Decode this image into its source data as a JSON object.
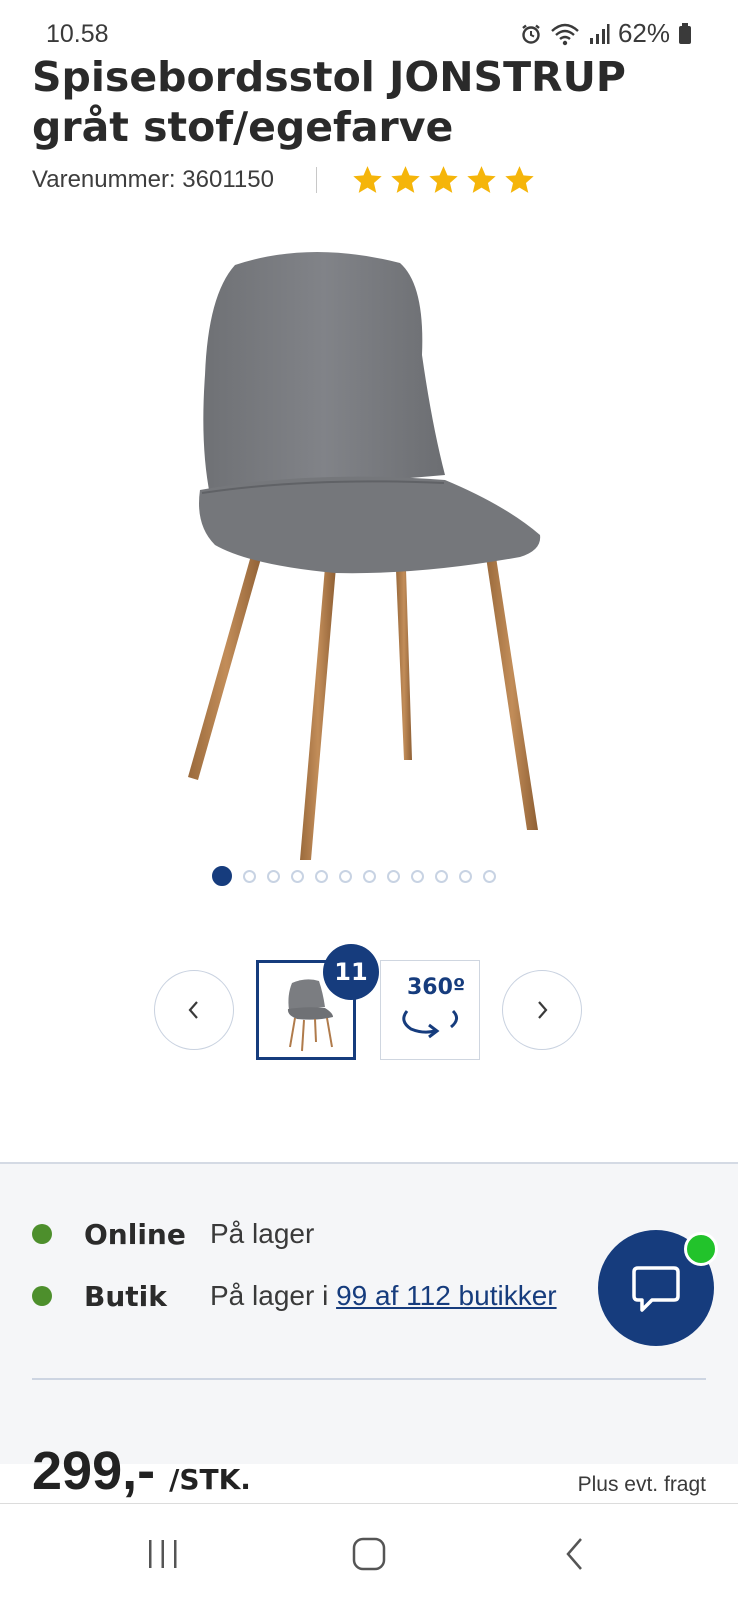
{
  "status_bar": {
    "time": "10.58",
    "battery": "62%"
  },
  "product": {
    "title": "Spisebordsstol JONSTRUP gråt stof/egefarve",
    "sku_label": "Varenummer: 3601150",
    "rating": {
      "stars": 5,
      "max": 5
    },
    "image_icon": "chair-product-image"
  },
  "gallery": {
    "dot_count": 12,
    "active_dot": 0,
    "image_count_badge": "11",
    "view_360_label": "360º",
    "prev_icon": "chevron-left-icon",
    "next_icon": "chevron-right-icon"
  },
  "stock": {
    "online": {
      "label": "Online",
      "value": "På lager"
    },
    "store": {
      "label": "Butik",
      "value_prefix": "På lager i ",
      "link": "99 af 112 butikker"
    }
  },
  "price": {
    "amount": "299,-",
    "unit": "/STK.",
    "shipping_note": "Plus evt. fragt"
  },
  "colors": {
    "brand_blue": "#163c7d",
    "star_gold": "#f5b50a",
    "stock_green": "#4d8f2c",
    "chat_online": "#22c32b"
  },
  "nav": {
    "icons": [
      "recents-icon",
      "home-icon",
      "back-icon"
    ]
  }
}
